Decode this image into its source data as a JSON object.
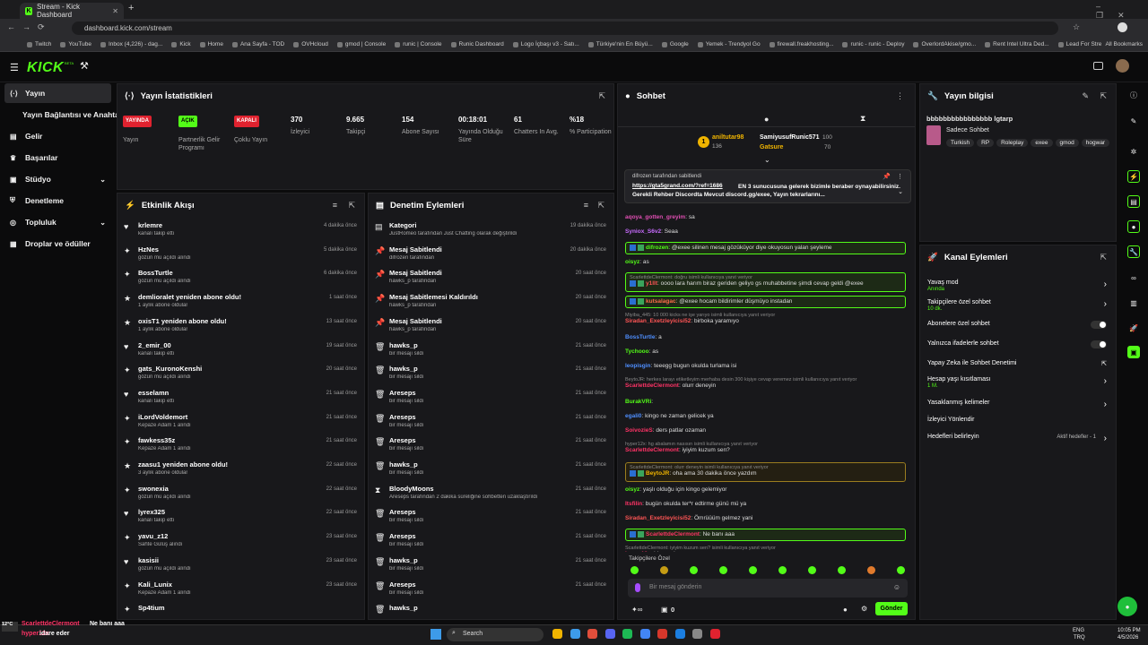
{
  "browser": {
    "tab_title": "Stream - Kick Dashboard",
    "url": "dashboard.kick.com/stream",
    "bookmarks": [
      "Twitch",
      "YouTube",
      "Inbox (4,226) - dag...",
      "Kick",
      "Home",
      "Ana Sayfa - TOD",
      "OVHcloud",
      "gmod | Console",
      "runic | Console",
      "Runic Dashboard",
      "Logo İçbaşı v3 - Satı...",
      "Türkiye'nin En Büyü...",
      "Google",
      "Yemek - Trendyol Go",
      "firewall.freakhosting...",
      "runic - runic - Deploy",
      "OverlordAkise/gmo...",
      "Rent Intel Ultra Ded...",
      "Lead For Streamers"
    ],
    "all_bookmarks": "All Bookmarks"
  },
  "app": {
    "logo": "KICK",
    "logo_sub": "BETA"
  },
  "sidebar": [
    {
      "label": "Yayın",
      "icon": "broadcast-icon",
      "active": true
    },
    {
      "label": "Yayın Bağlantısı ve Anahtarı",
      "icon": "",
      "active": false
    },
    {
      "label": "Gelir",
      "icon": "revenue-icon",
      "active": false
    },
    {
      "label": "Başarılar",
      "icon": "trophy-icon",
      "active": false
    },
    {
      "label": "Stüdyo",
      "icon": "studio-icon",
      "active": false,
      "chevron": true
    },
    {
      "label": "Denetleme",
      "icon": "shield-icon",
      "active": false
    },
    {
      "label": "Topluluk",
      "icon": "community-icon",
      "active": false,
      "chevron": true
    },
    {
      "label": "Droplar ve ödüller",
      "icon": "gift-icon",
      "active": false
    }
  ],
  "stats": {
    "title": "Yayın İstatistikleri",
    "cols": [
      {
        "badge": "YAYINDA",
        "badge_color": "#e0222f",
        "label": "Yayın"
      },
      {
        "badge": "AÇIK",
        "badge_color": "#53fc18",
        "label": "Partnerlik Gelir Programı"
      },
      {
        "badge": "KAPALI",
        "badge_color": "#e0222f",
        "label": "Çoklu Yayın"
      },
      {
        "value": "370",
        "label": "İzleyici"
      },
      {
        "value": "9.665",
        "label": "Takipçi"
      },
      {
        "value": "154",
        "label": "Abone Sayısı"
      },
      {
        "value": "00:18:01",
        "label": "Yayında Olduğu Süre"
      },
      {
        "value": "61",
        "label": "Chatters In Avg."
      },
      {
        "value": "%18",
        "label": "% Participation"
      }
    ]
  },
  "events": {
    "title": "Etkinlik Akışı",
    "items": [
      {
        "name": "krlemre",
        "sub": "kanalı takip etti",
        "time": "4 dakika önce",
        "icon": "♥"
      },
      {
        "name": "HzNes",
        "sub": "gözün mü açıldı alındı",
        "time": "5 dakika önce",
        "icon": "✦"
      },
      {
        "name": "BossTurtle",
        "sub": "gözün mü açıldı alındı",
        "time": "6 dakika önce",
        "icon": "✦"
      },
      {
        "name": "demlioralet yeniden abone oldu!",
        "sub": "1 aylık abone oldular",
        "time": "1 saat önce",
        "icon": "★"
      },
      {
        "name": "oxisT1 yeniden abone oldu!",
        "sub": "1 aylık abone oldular",
        "time": "13 saat önce",
        "icon": "★"
      },
      {
        "name": "2_emir_00",
        "sub": "kanalı takip etti",
        "time": "19 saat önce",
        "icon": "♥"
      },
      {
        "name": "gats_KuronoKenshi",
        "sub": "gözün mü açıldı alındı",
        "time": "20 saat önce",
        "icon": "✦"
      },
      {
        "name": "esselamn",
        "sub": "kanalı takip etti",
        "time": "21 saat önce",
        "icon": "♥"
      },
      {
        "name": "iLordVoldemort",
        "sub": "Kepaze Adam 1 alındı",
        "time": "21 saat önce",
        "icon": "✦"
      },
      {
        "name": "fawkess35z",
        "sub": "Kepaze Adam 1 alındı",
        "time": "21 saat önce",
        "icon": "✦"
      },
      {
        "name": "zaasu1 yeniden abone oldu!",
        "sub": "3 aylık abone oldular",
        "time": "22 saat önce",
        "icon": "★"
      },
      {
        "name": "swonexia",
        "sub": "gözün mü açıldı alındı",
        "time": "22 saat önce",
        "icon": "✦"
      },
      {
        "name": "lyrex325",
        "sub": "kanalı takip etti",
        "time": "22 saat önce",
        "icon": "♥"
      },
      {
        "name": "yavu_z12",
        "sub": "Sahte Gülüş alındı",
        "time": "23 saat önce",
        "icon": "✦"
      },
      {
        "name": "kasisii",
        "sub": "gözün mü açıldı alındı",
        "time": "23 saat önce",
        "icon": "♥"
      },
      {
        "name": "Kali_Lunix",
        "sub": "Kepaze Adam 1 alındı",
        "time": "23 saat önce",
        "icon": "✦"
      },
      {
        "name": "Sp4tium",
        "sub": "",
        "time": "",
        "icon": "✦"
      }
    ]
  },
  "modlog": {
    "title": "Denetim Eylemleri",
    "items": [
      {
        "name": "Kategori",
        "sub": "JustRomeo tarafından Just Chatting olarak değiştirildi",
        "time": "19 dakika önce",
        "icon": "▤"
      },
      {
        "name": "Mesaj Sabitlendi",
        "sub": "difrozen tarafından",
        "time": "20 dakika önce",
        "icon": "📌"
      },
      {
        "name": "Mesaj Sabitlendi",
        "sub": "hawks_p tarafından",
        "time": "20 saat önce",
        "icon": "📌"
      },
      {
        "name": "Mesaj Sabitlemesi Kaldırıldı",
        "sub": "hawks_p tarafından",
        "time": "20 saat önce",
        "icon": "📌"
      },
      {
        "name": "Mesaj Sabitlendi",
        "sub": "hawks_p tarafından",
        "time": "20 saat önce",
        "icon": "📌"
      },
      {
        "name": "hawks_p",
        "sub": "bir mesajı sildi",
        "time": "21 saat önce",
        "icon": "🗑"
      },
      {
        "name": "hawks_p",
        "sub": "bir mesajı sildi",
        "time": "21 saat önce",
        "icon": "🗑"
      },
      {
        "name": "Areseps",
        "sub": "bir mesajı sildi",
        "time": "21 saat önce",
        "icon": "🗑"
      },
      {
        "name": "Areseps",
        "sub": "bir mesajı sildi",
        "time": "21 saat önce",
        "icon": "🗑"
      },
      {
        "name": "Areseps",
        "sub": "bir mesajı sildi",
        "time": "21 saat önce",
        "icon": "🗑"
      },
      {
        "name": "hawks_p",
        "sub": "bir mesajı sildi",
        "time": "21 saat önce",
        "icon": "🗑"
      },
      {
        "name": "BloodyMoons",
        "sub": "Areseps tarafından 2 dakika süreliğine sohbetten uzaklaştırıldı",
        "time": "21 saat önce",
        "icon": "⧗"
      },
      {
        "name": "Areseps",
        "sub": "bir mesajı sildi",
        "time": "21 saat önce",
        "icon": "🗑"
      },
      {
        "name": "Areseps",
        "sub": "bir mesajı sildi",
        "time": "21 saat önce",
        "icon": "🗑"
      },
      {
        "name": "hawks_p",
        "sub": "bir mesajı sildi",
        "time": "21 saat önce",
        "icon": "🗑"
      },
      {
        "name": "Areseps",
        "sub": "bir mesajı sildi",
        "time": "21 saat önce",
        "icon": "🗑"
      },
      {
        "name": "hawks_p",
        "sub": "",
        "time": "",
        "icon": "🗑"
      }
    ]
  },
  "chat": {
    "title": "Sohbet",
    "top1_name": "aniltutar98",
    "top1_val": "136",
    "top2_name": "SamiyusufRunic571",
    "top2_val": "100",
    "top3_name": "Gatsure",
    "top3_val": "70",
    "pinned_by": "difrozen tarafından sabitlendi",
    "pinned_link": "https://gta5grand.com/?ref=1686",
    "pinned_text": "EN 3 sunucusuna gelerek bizimle beraber oynayabilirsiniz. Gerekli Rehber Discordta Mevcut discord.gg/exee, Yayın tekrarlarını...",
    "messages": [
      {
        "user": "aqoya_gotten_greyim",
        "color": "#e04eb3",
        "text": "sa",
        "style": ""
      },
      {
        "user": "Syniox_S6v2",
        "color": "#c86bff",
        "text": "Seaa",
        "style": ""
      },
      {
        "user": "difrozen",
        "color": "#53fc18",
        "text": "@exee silinen mesaj gözüküyor diye okuyosun yalan şeyleme",
        "style": "hl",
        "reply": ""
      },
      {
        "user": "oisyz",
        "color": "#53fc18",
        "text": "as",
        "style": ""
      },
      {
        "user": "y1llt",
        "color": "#ff5555",
        "text": "oooo lara harım biraz geriden geliyo gs muhabbetine şimdi cevap geldi @exee",
        "style": "hl",
        "reply": "ScarlettdeClermont: doğru isimli kullanıcıya yanıt veriyor"
      },
      {
        "user": "kutsalagac",
        "color": "#ff6b4a",
        "text": "@exee hocam bildirimler düşmüyo instadan",
        "style": "hl",
        "reply": ""
      },
      {
        "user": "Siradan_Exetzleyicisi52",
        "color": "#ff5555",
        "text": "birboka yaramıyo",
        "style": "",
        "reply": "Miyiba_445: 10 000 kicks ne işe yarıyo isimli kullanıcıya yanıt veriyor"
      },
      {
        "user": "BossTurtle",
        "color": "#4f8fff",
        "text": "a",
        "style": ""
      },
      {
        "user": "Tychooo",
        "color": "#53fc18",
        "text": "as",
        "style": ""
      },
      {
        "user": "leopisgin",
        "color": "#4f8fff",
        "text": "teeegg bugun okulda turlama isi",
        "style": ""
      },
      {
        "user": "ScarlettdeClermont",
        "color": "#ff3366",
        "text": "olurr deneyin",
        "style": "",
        "reply": "BeytoJR: herkes larayı etiketleyim merhaba desin 300 kişiye cevap veremez isimli kullanıcıya yanıt veriyor"
      },
      {
        "user": "BurakVRi",
        "color": "#53fc18",
        "text": "",
        "style": ""
      },
      {
        "user": "egali0",
        "color": "#4f8fff",
        "text": "kingo ne zaman gelicek ya",
        "style": ""
      },
      {
        "user": "SoivozieS",
        "color": "#ff3366",
        "text": "ders patlar ozaman",
        "style": ""
      },
      {
        "user": "ScarlettdeClermont",
        "color": "#ff3366",
        "text": "iyiyim kuzum sen?",
        "style": "",
        "reply": "hyper12x: hg abalamın nasısın isimli kullanıcıya yanıt veriyor"
      },
      {
        "user": "BeytoJR",
        "color": "#f0b400",
        "text": "oha ama 30 dakika önce yazdım",
        "style": "hl2",
        "reply": "ScarlettdeClermont: olurr deneyin isimli kullanıcıya yanıt veriyor"
      },
      {
        "user": "oisyz",
        "color": "#53fc18",
        "text": "yaşlı olduğu için kingo gelemiyor",
        "style": ""
      },
      {
        "user": "Itsfilin",
        "color": "#ff3366",
        "text": "bugün okulda ter*r edtirme günü mü ya",
        "style": ""
      },
      {
        "user": "Siradan_Exetzleyicisi52",
        "color": "#ff5555",
        "text": "Ömrüüüm gelmez yani",
        "style": ""
      },
      {
        "user": "ScarlettdeClermont",
        "color": "#ff3366",
        "text": "Ne banı aaa",
        "style": "hl",
        "reply": ""
      },
      {
        "user": "hyper12x",
        "color": "#ff3366",
        "text": "idare eder",
        "style": "",
        "reply": "ScarlettdeClermont: iyiyim kuzum sen? isimli kullanıcıya yanıt veriyor"
      }
    ],
    "followers_only": "Takipçilere Özel",
    "input_placeholder": "Bir mesaj gönderin",
    "send_label": "Gönder",
    "count": "0"
  },
  "stream_info": {
    "title": "Yayın bilgisi",
    "stream_title": "bbbbbbbbbbbbbbbb lgtarp",
    "mode": "Sadece Sohbet",
    "tags": [
      "Turkish",
      "RP",
      "Roleplay",
      "exee",
      "gmod",
      "hogwar"
    ]
  },
  "channel_actions": {
    "title": "Kanal Eylemleri",
    "items": [
      {
        "label": "Yavaş mod",
        "sub": "Anında",
        "type": "arrow"
      },
      {
        "label": "Takipçilere özel sohbet",
        "sub": "10 dk.",
        "type": "arrow"
      },
      {
        "label": "Abonelere özel sohbet",
        "sub": "",
        "type": "toggle"
      },
      {
        "label": "Yalnızca ifadelerle sohbet",
        "sub": "",
        "type": "toggle"
      },
      {
        "label": "Yapay Zeka ile Sohbet Denetimi",
        "sub": "",
        "type": "ext"
      },
      {
        "label": "Hesap yaşı kısıtlaması",
        "sub": "1 M.",
        "type": "arrow"
      },
      {
        "label": "Yasaklanmış kelimeler",
        "sub": "",
        "type": "arrow"
      },
      {
        "label": "İzleyici Yönlendir",
        "sub": "",
        "type": ""
      },
      {
        "label": "Hedefleri belirleyin",
        "sub": "",
        "type": "arrow",
        "right": "Aktif hedefler - 1"
      }
    ]
  },
  "overlay": {
    "user": "ScarlettdeClermont",
    "text": "Ne banı aaa",
    "user2": "hyper12x",
    "text2": "idare eder",
    "weather": "12°C"
  },
  "taskbar": {
    "search": "Search",
    "lang": "ENG",
    "lang2": "TRQ",
    "time": "10:05 PM",
    "date": "4/5/2026"
  }
}
